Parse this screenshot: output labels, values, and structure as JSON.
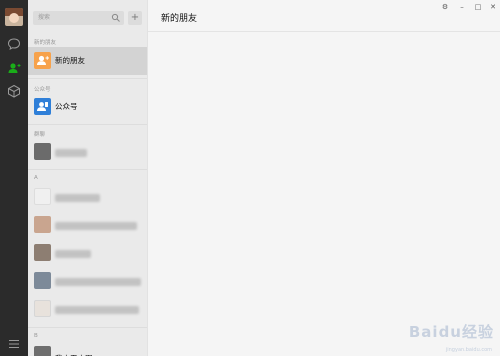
{
  "window": {
    "controls": [
      "⚙",
      "–",
      "□",
      "✕"
    ]
  },
  "rail": {
    "icons": [
      "avatar",
      "chat-icon",
      "contacts-icon",
      "collection-icon",
      "menu-icon"
    ]
  },
  "search": {
    "placeholder": "搜索",
    "add_label": "+"
  },
  "contacts": {
    "sections": {
      "new_friends": "新的朋友",
      "official_accounts": "公众号",
      "group_chats": "群聊",
      "letter_a": "A",
      "letter_b": "B"
    },
    "new_friends_label": "新的朋友",
    "official_accounts_label": "公众号",
    "bottom_partial_label": "我小天小田"
  },
  "main": {
    "title": "新的朋友"
  },
  "watermark": {
    "text": "Baidu经验",
    "sub": "jingyan.baidu.com"
  },
  "colors": {
    "rail_bg": "#2b2b2b",
    "active_icon": "#1aad19",
    "new_friend_icon": "#f7a24b",
    "official_icon": "#2f7fd8"
  }
}
